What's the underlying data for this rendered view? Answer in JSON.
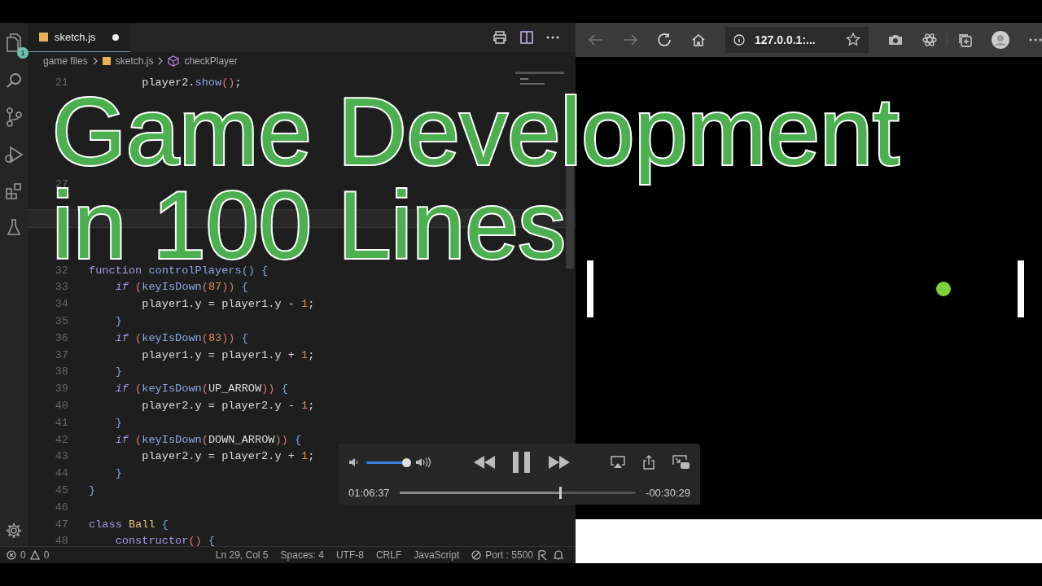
{
  "editor": {
    "tab": {
      "label": "sketch.js",
      "modified": true
    },
    "explorer_badge": "1",
    "breadcrumb": [
      "game files",
      "sketch.js",
      "checkPlayer"
    ],
    "lines": [
      {
        "number": "21",
        "current": false,
        "tokens": [
          {
            "text": "        player2.",
            "kind": "var"
          },
          {
            "text": "show",
            "kind": "func"
          },
          {
            "text": "()",
            "kind": "paren"
          },
          {
            "text": ";",
            "kind": "var"
          }
        ]
      },
      {
        "current": false
      },
      {
        "current": false
      },
      {
        "current": false
      },
      {
        "current": false
      },
      {
        "current": false
      },
      {
        "number": "27",
        "current": false
      },
      {
        "current": false
      },
      {
        "current": true
      },
      {
        "current": false
      },
      {
        "current": false
      },
      {
        "number": "32",
        "current": false,
        "tokens": [
          {
            "text": "function ",
            "kind": "keyword"
          },
          {
            "text": "controlPlayers",
            "kind": "func"
          },
          {
            "text": "() {",
            "kind": "brace"
          }
        ]
      },
      {
        "number": "33",
        "current": false,
        "tokens": [
          {
            "text": "    if",
            "kind": "control"
          },
          {
            "text": " (",
            "kind": "paren"
          },
          {
            "text": "keyIsDown",
            "kind": "func"
          },
          {
            "text": "(",
            "kind": "paren"
          },
          {
            "text": "87",
            "kind": "number"
          },
          {
            "text": "))",
            "kind": "paren"
          },
          {
            "text": " {",
            "kind": "brace"
          }
        ]
      },
      {
        "number": "34",
        "current": false,
        "tokens": [
          {
            "text": "        player1.y = player1.y - ",
            "kind": "var"
          },
          {
            "text": "1",
            "kind": "number"
          },
          {
            "text": ";",
            "kind": "var"
          }
        ]
      },
      {
        "number": "35",
        "current": false,
        "tokens": [
          {
            "text": "    }",
            "kind": "brace"
          }
        ]
      },
      {
        "number": "36",
        "current": false,
        "tokens": [
          {
            "text": "    if",
            "kind": "control"
          },
          {
            "text": " (",
            "kind": "paren"
          },
          {
            "text": "keyIsDown",
            "kind": "func"
          },
          {
            "text": "(",
            "kind": "paren"
          },
          {
            "text": "83",
            "kind": "number"
          },
          {
            "text": "))",
            "kind": "paren"
          },
          {
            "text": " {",
            "kind": "brace"
          }
        ]
      },
      {
        "number": "37",
        "current": false,
        "tokens": [
          {
            "text": "        player1.y = player1.y + ",
            "kind": "var"
          },
          {
            "text": "1",
            "kind": "number"
          },
          {
            "text": ";",
            "kind": "var"
          }
        ]
      },
      {
        "number": "38",
        "current": false,
        "tokens": [
          {
            "text": "    }",
            "kind": "brace"
          }
        ]
      },
      {
        "number": "39",
        "current": false,
        "tokens": [
          {
            "text": "    if",
            "kind": "control"
          },
          {
            "text": " (",
            "kind": "paren"
          },
          {
            "text": "keyIsDown",
            "kind": "func"
          },
          {
            "text": "(",
            "kind": "paren"
          },
          {
            "text": "UP_ARROW",
            "kind": "var"
          },
          {
            "text": "))",
            "kind": "paren"
          },
          {
            "text": " {",
            "kind": "brace"
          }
        ]
      },
      {
        "number": "40",
        "current": false,
        "tokens": [
          {
            "text": "        player2.y = player2.y - ",
            "kind": "var"
          },
          {
            "text": "1",
            "kind": "number"
          },
          {
            "text": ";",
            "kind": "var"
          }
        ]
      },
      {
        "number": "41",
        "current": false,
        "tokens": [
          {
            "text": "    }",
            "kind": "brace"
          }
        ]
      },
      {
        "number": "42",
        "current": false,
        "tokens": [
          {
            "text": "    if",
            "kind": "control"
          },
          {
            "text": " (",
            "kind": "paren"
          },
          {
            "text": "keyIsDown",
            "kind": "func"
          },
          {
            "text": "(",
            "kind": "paren"
          },
          {
            "text": "DOWN_ARROW",
            "kind": "var"
          },
          {
            "text": "))",
            "kind": "paren"
          },
          {
            "text": " {",
            "kind": "brace"
          }
        ]
      },
      {
        "number": "43",
        "current": false,
        "tokens": [
          {
            "text": "        player2.y = player2.y + ",
            "kind": "var"
          },
          {
            "text": "1",
            "kind": "number"
          },
          {
            "text": ";",
            "kind": "var"
          }
        ]
      },
      {
        "number": "44",
        "current": false,
        "tokens": [
          {
            "text": "    }",
            "kind": "brace"
          }
        ]
      },
      {
        "number": "45",
        "current": false,
        "tokens": [
          {
            "text": "}",
            "kind": "brace"
          }
        ]
      },
      {
        "number": "46",
        "current": false
      },
      {
        "number": "47",
        "current": false,
        "tokens": [
          {
            "text": "class ",
            "kind": "keyword"
          },
          {
            "text": "Ball",
            "kind": "class"
          },
          {
            "text": " {",
            "kind": "brace"
          }
        ]
      },
      {
        "number": "48",
        "current": false,
        "tokens": [
          {
            "text": "    constructor",
            "kind": "keyword"
          },
          {
            "text": "()",
            "kind": "paren"
          },
          {
            "text": " {",
            "kind": "brace"
          }
        ]
      }
    ],
    "status_bar": {
      "errors": "0",
      "warnings": "0",
      "items": [
        "Ln 29, Col 5",
        "Spaces: 4",
        "UTF-8",
        "CRLF",
        "JavaScript"
      ],
      "port": "Port : 5500"
    }
  },
  "browser": {
    "address": "127.0.0.1:..."
  },
  "title_overlay": [
    "Game Development",
    "in 100 Lines"
  ],
  "player": {
    "playing": true,
    "volume": {
      "level": 0.95
    },
    "elapsed": "01:06:37",
    "progress": {
      "level": 0.68
    },
    "remaining": "-00:30:29"
  }
}
